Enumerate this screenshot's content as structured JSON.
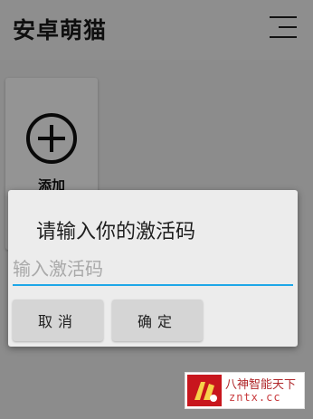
{
  "app": {
    "title": "安卓萌猫",
    "menu_icon": "hamburger-menu-icon"
  },
  "content": {
    "add_card": {
      "icon": "circle-plus-icon",
      "label": "添加"
    }
  },
  "dialog": {
    "title": "请输入你的激活码",
    "input": {
      "value": "",
      "placeholder": "输入激活码"
    },
    "cancel_label": "取消",
    "ok_label": "确定",
    "accent_color": "#1ea7e8"
  },
  "watermark": {
    "text_cn": "八神智能天下",
    "text_en": "zntx.cc",
    "logo_color": "#c8161d"
  }
}
